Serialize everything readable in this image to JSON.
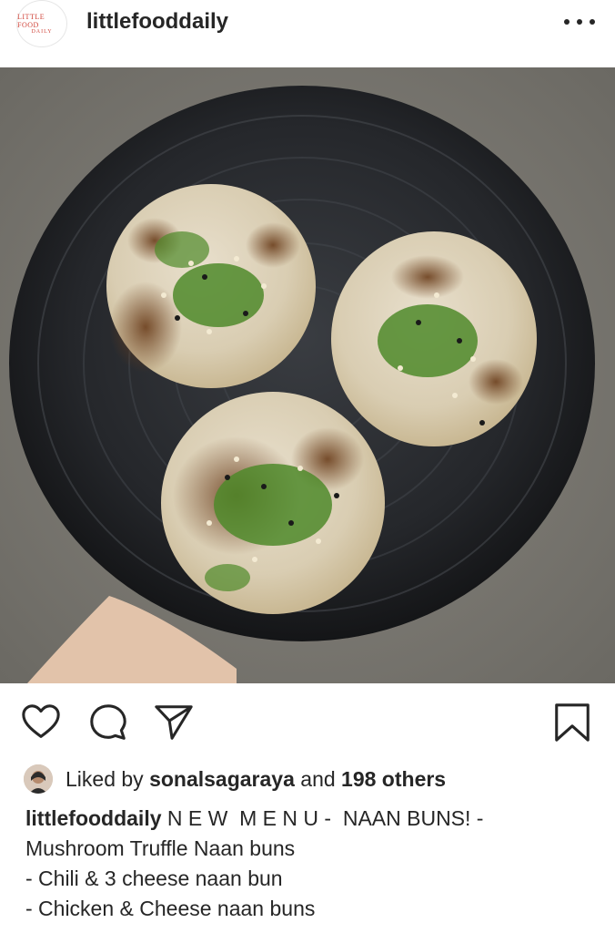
{
  "post": {
    "username": "littlefooddaily",
    "avatar_logo_top": "LITTLE FOOD",
    "avatar_logo_bottom": "DAILY",
    "more_icon": "more-horizontal-icon"
  },
  "photo": {
    "description_icon": "post-image"
  },
  "actions": {
    "like_icon": "heart-icon",
    "comment_icon": "comment-icon",
    "share_icon": "send-icon",
    "save_icon": "bookmark-icon"
  },
  "likes": {
    "prefix": "Liked by",
    "liker": "sonalsagaraya",
    "middle": "and",
    "others": "198 others"
  },
  "caption": {
    "author": "littlefooddaily",
    "line1": "N E W  M E N U -  NAAN BUNS! -",
    "line2": "Mushroom Truffle Naan buns",
    "line3": "- Chili & 3 cheese naan bun",
    "line4": "- Chicken & Cheese naan buns"
  },
  "colors": {
    "text": "#262626",
    "background": "#ffffff"
  }
}
